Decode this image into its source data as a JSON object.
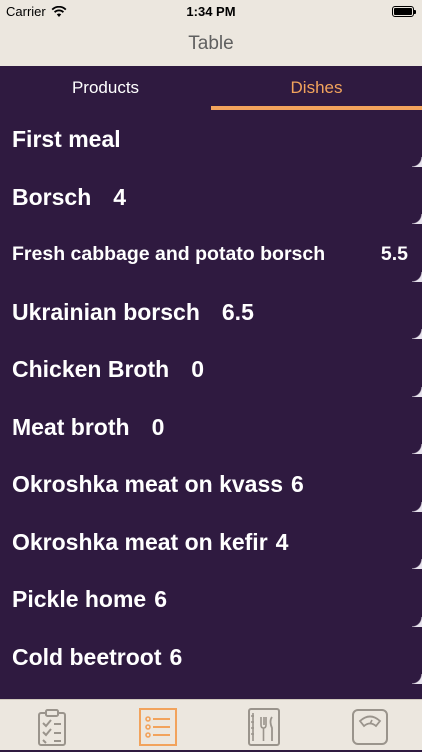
{
  "status_bar": {
    "carrier": "Carrier",
    "time": "1:34 PM",
    "battery_level": 1.0
  },
  "nav": {
    "title": "Table"
  },
  "tabs": [
    {
      "label": "Products",
      "selected": false
    },
    {
      "label": "Dishes",
      "selected": true
    }
  ],
  "list": [
    {
      "name": "First meal",
      "value": ""
    },
    {
      "name": "Borsch",
      "value": "4"
    },
    {
      "name": "Fresh cabbage and potato borsch",
      "value": "5.5"
    },
    {
      "name": "Ukrainian borsch",
      "value": "6.5"
    },
    {
      "name": "Chicken Broth",
      "value": "0"
    },
    {
      "name": "Meat broth",
      "value": "0"
    },
    {
      "name": "Okroshka meat on kvass",
      "value": "6"
    },
    {
      "name": "Okroshka meat on kefir",
      "value": "4"
    },
    {
      "name": "Pickle home",
      "value": "6"
    },
    {
      "name": "Cold beetroot",
      "value": "6"
    }
  ],
  "tab_bar": [
    {
      "icon": "clipboard-checklist-icon",
      "selected": false
    },
    {
      "icon": "list-icon",
      "selected": true
    },
    {
      "icon": "menu-book-icon",
      "selected": false
    },
    {
      "icon": "scale-icon",
      "selected": false
    }
  ],
  "colors": {
    "background": "#2f1a40",
    "accent": "#f2a35c",
    "bar": "#ece7df",
    "icon_inactive": "#9a948c"
  }
}
